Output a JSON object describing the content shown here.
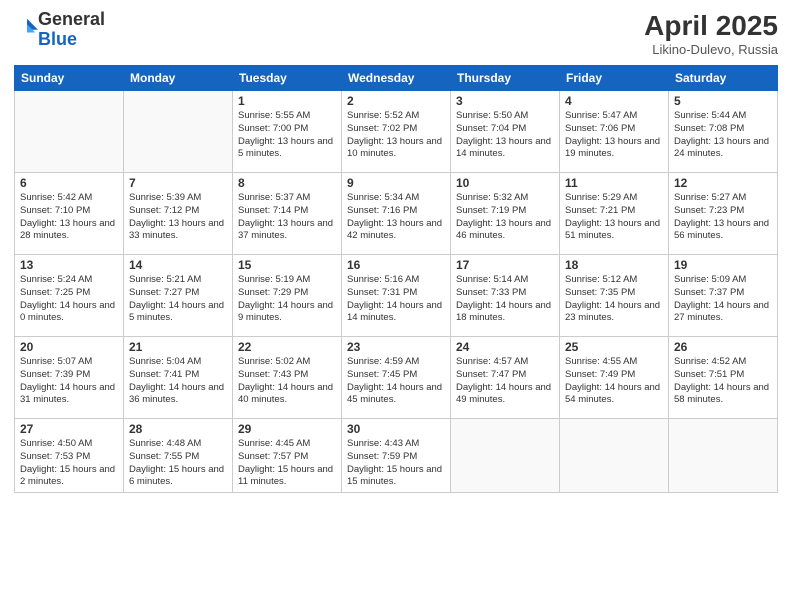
{
  "logo": {
    "general": "General",
    "blue": "Blue"
  },
  "title": "April 2025",
  "location": "Likino-Dulevo, Russia",
  "days_of_week": [
    "Sunday",
    "Monday",
    "Tuesday",
    "Wednesday",
    "Thursday",
    "Friday",
    "Saturday"
  ],
  "weeks": [
    [
      {
        "day": "",
        "info": ""
      },
      {
        "day": "",
        "info": ""
      },
      {
        "day": "1",
        "info": "Sunrise: 5:55 AM\nSunset: 7:00 PM\nDaylight: 13 hours and 5 minutes."
      },
      {
        "day": "2",
        "info": "Sunrise: 5:52 AM\nSunset: 7:02 PM\nDaylight: 13 hours and 10 minutes."
      },
      {
        "day": "3",
        "info": "Sunrise: 5:50 AM\nSunset: 7:04 PM\nDaylight: 13 hours and 14 minutes."
      },
      {
        "day": "4",
        "info": "Sunrise: 5:47 AM\nSunset: 7:06 PM\nDaylight: 13 hours and 19 minutes."
      },
      {
        "day": "5",
        "info": "Sunrise: 5:44 AM\nSunset: 7:08 PM\nDaylight: 13 hours and 24 minutes."
      }
    ],
    [
      {
        "day": "6",
        "info": "Sunrise: 5:42 AM\nSunset: 7:10 PM\nDaylight: 13 hours and 28 minutes."
      },
      {
        "day": "7",
        "info": "Sunrise: 5:39 AM\nSunset: 7:12 PM\nDaylight: 13 hours and 33 minutes."
      },
      {
        "day": "8",
        "info": "Sunrise: 5:37 AM\nSunset: 7:14 PM\nDaylight: 13 hours and 37 minutes."
      },
      {
        "day": "9",
        "info": "Sunrise: 5:34 AM\nSunset: 7:16 PM\nDaylight: 13 hours and 42 minutes."
      },
      {
        "day": "10",
        "info": "Sunrise: 5:32 AM\nSunset: 7:19 PM\nDaylight: 13 hours and 46 minutes."
      },
      {
        "day": "11",
        "info": "Sunrise: 5:29 AM\nSunset: 7:21 PM\nDaylight: 13 hours and 51 minutes."
      },
      {
        "day": "12",
        "info": "Sunrise: 5:27 AM\nSunset: 7:23 PM\nDaylight: 13 hours and 56 minutes."
      }
    ],
    [
      {
        "day": "13",
        "info": "Sunrise: 5:24 AM\nSunset: 7:25 PM\nDaylight: 14 hours and 0 minutes."
      },
      {
        "day": "14",
        "info": "Sunrise: 5:21 AM\nSunset: 7:27 PM\nDaylight: 14 hours and 5 minutes."
      },
      {
        "day": "15",
        "info": "Sunrise: 5:19 AM\nSunset: 7:29 PM\nDaylight: 14 hours and 9 minutes."
      },
      {
        "day": "16",
        "info": "Sunrise: 5:16 AM\nSunset: 7:31 PM\nDaylight: 14 hours and 14 minutes."
      },
      {
        "day": "17",
        "info": "Sunrise: 5:14 AM\nSunset: 7:33 PM\nDaylight: 14 hours and 18 minutes."
      },
      {
        "day": "18",
        "info": "Sunrise: 5:12 AM\nSunset: 7:35 PM\nDaylight: 14 hours and 23 minutes."
      },
      {
        "day": "19",
        "info": "Sunrise: 5:09 AM\nSunset: 7:37 PM\nDaylight: 14 hours and 27 minutes."
      }
    ],
    [
      {
        "day": "20",
        "info": "Sunrise: 5:07 AM\nSunset: 7:39 PM\nDaylight: 14 hours and 31 minutes."
      },
      {
        "day": "21",
        "info": "Sunrise: 5:04 AM\nSunset: 7:41 PM\nDaylight: 14 hours and 36 minutes."
      },
      {
        "day": "22",
        "info": "Sunrise: 5:02 AM\nSunset: 7:43 PM\nDaylight: 14 hours and 40 minutes."
      },
      {
        "day": "23",
        "info": "Sunrise: 4:59 AM\nSunset: 7:45 PM\nDaylight: 14 hours and 45 minutes."
      },
      {
        "day": "24",
        "info": "Sunrise: 4:57 AM\nSunset: 7:47 PM\nDaylight: 14 hours and 49 minutes."
      },
      {
        "day": "25",
        "info": "Sunrise: 4:55 AM\nSunset: 7:49 PM\nDaylight: 14 hours and 54 minutes."
      },
      {
        "day": "26",
        "info": "Sunrise: 4:52 AM\nSunset: 7:51 PM\nDaylight: 14 hours and 58 minutes."
      }
    ],
    [
      {
        "day": "27",
        "info": "Sunrise: 4:50 AM\nSunset: 7:53 PM\nDaylight: 15 hours and 2 minutes."
      },
      {
        "day": "28",
        "info": "Sunrise: 4:48 AM\nSunset: 7:55 PM\nDaylight: 15 hours and 6 minutes."
      },
      {
        "day": "29",
        "info": "Sunrise: 4:45 AM\nSunset: 7:57 PM\nDaylight: 15 hours and 11 minutes."
      },
      {
        "day": "30",
        "info": "Sunrise: 4:43 AM\nSunset: 7:59 PM\nDaylight: 15 hours and 15 minutes."
      },
      {
        "day": "",
        "info": ""
      },
      {
        "day": "",
        "info": ""
      },
      {
        "day": "",
        "info": ""
      }
    ]
  ]
}
